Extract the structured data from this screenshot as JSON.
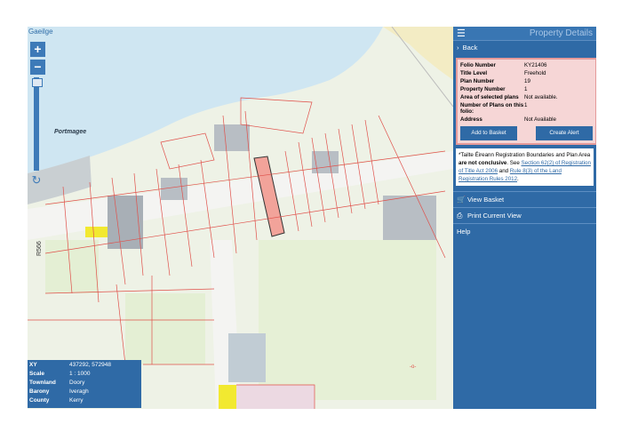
{
  "map": {
    "language_link": "Gaeilge",
    "zoom_in": "+",
    "zoom_out": "−",
    "place_label": "Portmagee",
    "road_label": "R566",
    "zoom_in_icon": "plus-icon",
    "zoom_out_icon": "minus-icon",
    "refresh_icon": "refresh-icon"
  },
  "info_box": {
    "rows": [
      {
        "key": "XY",
        "value": "437292, 572948"
      },
      {
        "key": "Scale",
        "value": "1 : 1000"
      },
      {
        "key": "Townland",
        "value": "Doory"
      },
      {
        "key": "Barony",
        "value": "Iveragh"
      },
      {
        "key": "County",
        "value": "Kerry"
      }
    ]
  },
  "panel": {
    "title": "Property Details",
    "menu_icon": "hamburger-icon",
    "back_label": "Back",
    "details": {
      "folio_label": "Folio Number",
      "folio_value": "KY21406",
      "title_level_label": "Title Level",
      "title_level_value": "Freehold",
      "plan_label": "Plan Number",
      "plan_value": "19",
      "property_label": "Property Number",
      "property_value": "1",
      "area_label": "Area of selected plans",
      "area_value": "Not available.",
      "num_plans_label": "Number of Plans on this folio:",
      "num_plans_value": "1",
      "address_label": "Address",
      "address_value": "Not Available"
    },
    "add_to_basket": "Add to Basket",
    "create_alert": "Create Alert",
    "note": {
      "part1": "*Tailte Éireann Registration Boundaries and Plan Area ",
      "bold": "are not conclusive",
      "part2": ". See ",
      "link1": "Section 62(2) of Registration of Title Act 2006",
      "part3": " and ",
      "link2": "Rule 8(3) of the Land Registration Rules 2012",
      "part4": "."
    },
    "view_basket": "View Basket",
    "print_view": "Print Current View",
    "help": "Help"
  },
  "colors": {
    "accent": "#2f6aa6",
    "selected_plot": "#f2a39a",
    "boundary": "#e0504a",
    "sea": "#cfe6f2",
    "highlight": "#f2e930"
  }
}
